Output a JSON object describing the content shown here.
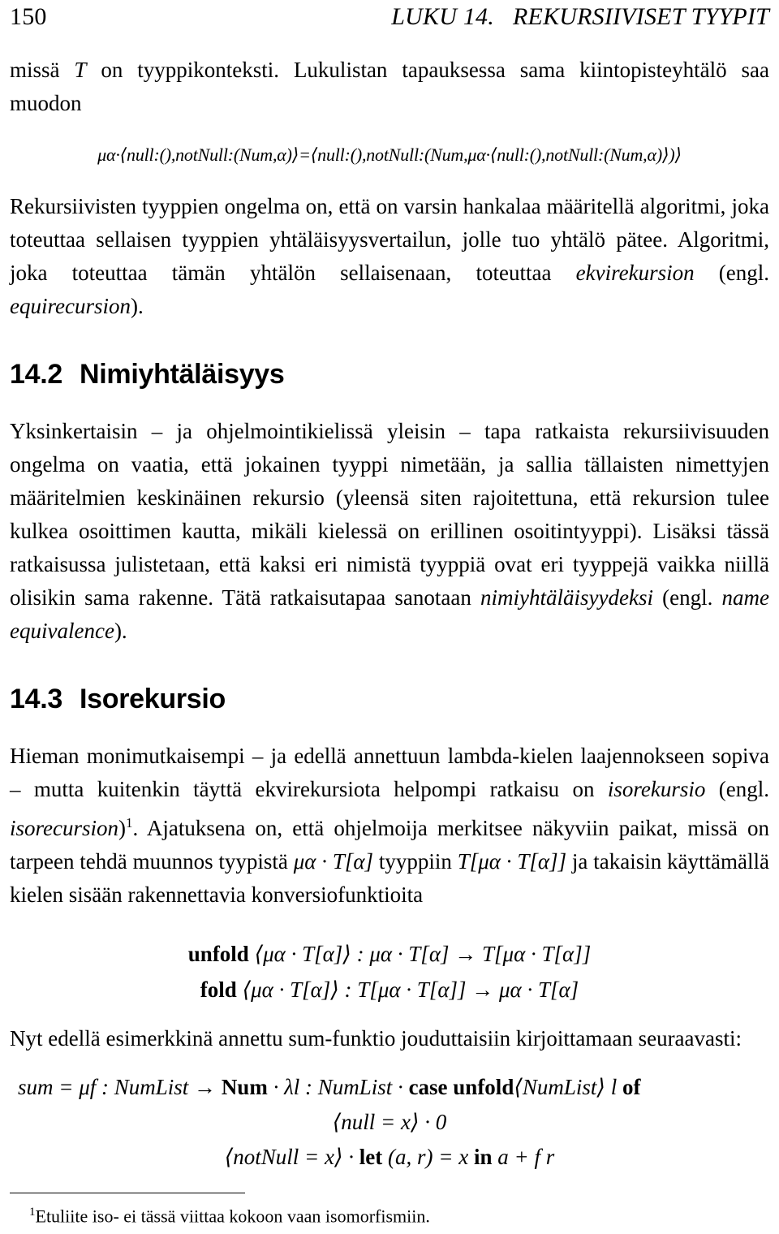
{
  "header": {
    "folio": "150",
    "chapter_title": "LUKU 14.   REKURSIIVISET TYYPIT"
  },
  "body": {
    "intro_paragraph": {
      "before_var": "missä ",
      "var": "T",
      "after_var": " on tyyppikonteksti. Lukulistan tapauksessa sama kiintopisteyhtälö saa muodon"
    },
    "fixpoint_equation": "μα·⟨null:(),notNull:(Num,α)⟩=⟨null:(),notNull:(Num,μα·⟨null:(),notNull:(Num,α)⟩)⟩",
    "equirecursion_paragraph": {
      "text_1": "Rekursiivisten tyyppien ongelma on, että on varsin hankalaa määritellä algoritmi, joka toteuttaa sellaisen tyyppien yhtäläisyysvertailun, jolle tuo yhtälö pätee. Algoritmi, joka toteuttaa tämän yhtälön sellaisenaan, toteuttaa ",
      "emph_fi": "ekvirekursion",
      "text_2": " (engl. ",
      "emph_en": "equirecursion",
      "text_3": ")."
    }
  },
  "sections": [
    {
      "number": "14.2",
      "title": "Nimiyhtäläisyys",
      "paragraph": {
        "text_1": "Yksinkertaisin – ja ohjelmointikielissä yleisin – tapa ratkaista rekursiivisuuden ongelma on vaatia, että jokainen tyyppi nimetään, ja sallia tällaisten nimettyjen määritelmien keskinäinen rekursio (yleensä siten rajoitettuna, että rekursion tulee kulkea osoittimen kautta, mikäli kielessä on erillinen osoitintyyppi). Lisäksi tässä ratkaisussa julistetaan, että kaksi eri nimistä tyyppiä ovat eri tyyppejä vaikka niillä olisikin sama rakenne. Tätä ratkaisutapaa sanotaan ",
        "emph_fi": "nimiyhtäläisyydeksi",
        "text_2": " (engl. ",
        "emph_en": "name equivalence",
        "text_3": ")."
      }
    },
    {
      "number": "14.3",
      "title": "Isorekursio",
      "paragraph": {
        "text_1": "Hieman monimutkaisempi – ja edellä annettuun lambda-kielen laajennokseen sopiva – mutta kuitenkin täyttä ekvirekursiota helpompi ratkaisu on ",
        "emph_fi": "isorekursio",
        "text_2": " (engl. ",
        "emph_en": "isorecursion",
        "footnote_marker": "1",
        "text_3": ". Ajatuksena on, että ohjelmoija merkitsee näkyviin paikat, missä on tarpeen tehdä muunnos tyypistä ",
        "math_1": "μα · T[α]",
        "text_4": " tyyppiin ",
        "math_2": "T[μα · T[α]]",
        "text_5": " ja takaisin käyttämällä kielen sisään rakennettavia konversiofunktioita"
      }
    }
  ],
  "conversion_equations": [
    {
      "keyword": "unfold",
      "body": " ⟨μα · T[α]⟩ : μα · T[α] → T[μα · T[α]]"
    },
    {
      "keyword": "fold",
      "body": " ⟨μα · T[α]⟩ : T[μα · T[α]] → μα · T[α]"
    }
  ],
  "sum_intro_paragraph": "Nyt edellä esimerkkinä annettu sum-funktio jouduttaisiin kirjoittamaan seuraavasti:",
  "sum_definition": {
    "line_1_parts": {
      "a": "sum = μf : NumList → ",
      "bold_num": "Num",
      "b": " · λl : NumList · ",
      "bold_case_unfold": "case unfold",
      "c": "⟨NumList⟩ l ",
      "bold_of": "of"
    },
    "line_2": "⟨null = x⟩ · 0",
    "line_3_parts": {
      "a": "⟨notNull = x⟩ · ",
      "bold_let": "let",
      "b": " (a, r) = x ",
      "bold_in": "in",
      "c": " a + f r"
    }
  },
  "footnote": {
    "marker": "1",
    "text": "Etuliite iso- ei tässä viittaa kokoon vaan isomorfismiin."
  }
}
